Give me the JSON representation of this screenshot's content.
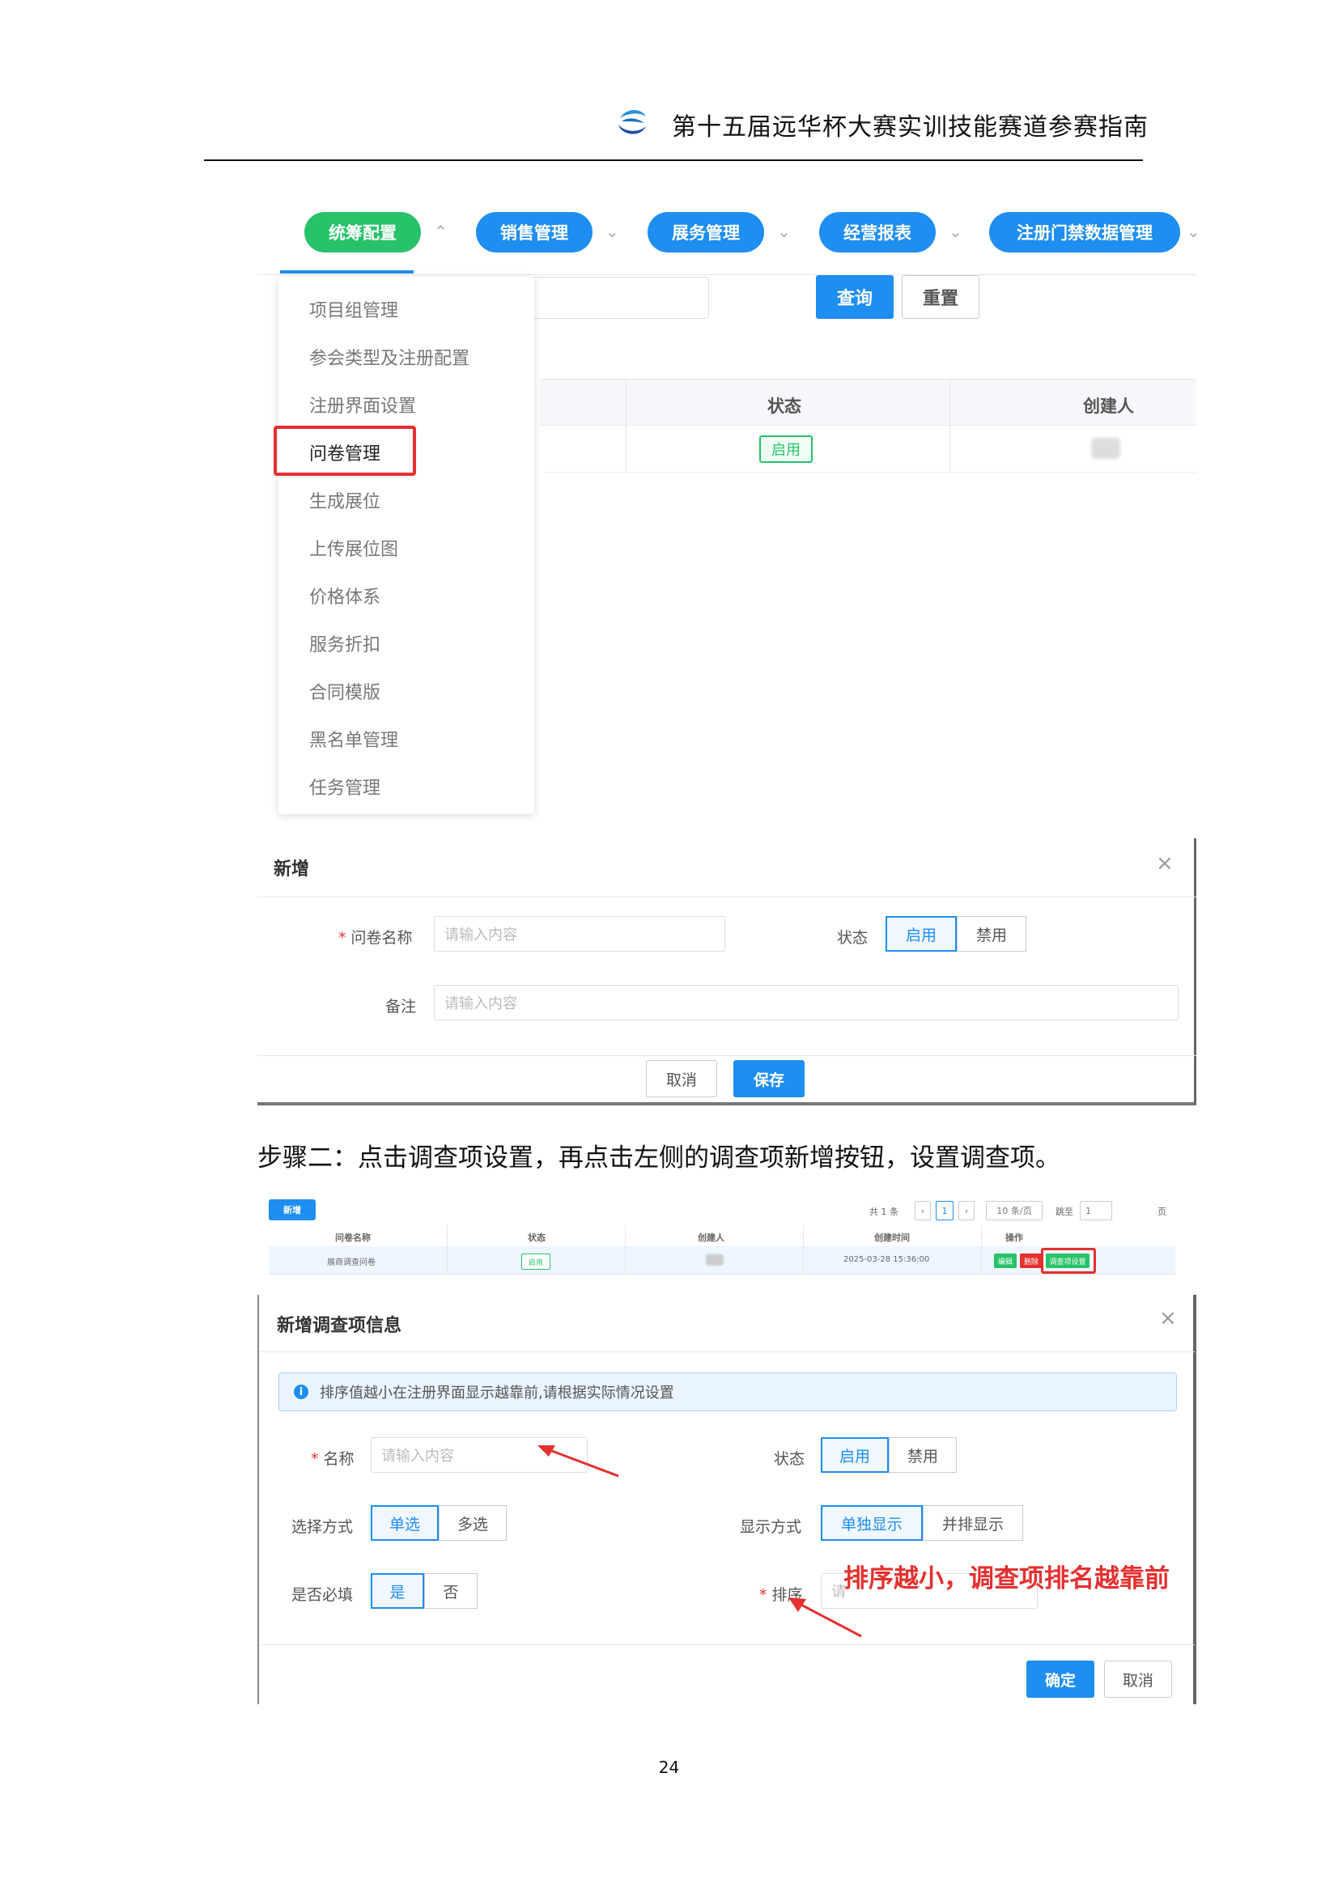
{
  "header": {
    "title": "第十五届远华杯大赛实训技能赛道参赛指南"
  },
  "screenshot1": {
    "nav": [
      {
        "label": "统筹配置",
        "color": "#27c26a"
      },
      {
        "label": "销售管理",
        "color": "#1e8ef0"
      },
      {
        "label": "展务管理",
        "color": "#1e8ef0"
      },
      {
        "label": "经营报表",
        "color": "#1e8ef0"
      },
      {
        "label": "注册门禁数据管理",
        "color": "#1e8ef0"
      }
    ],
    "query_label": "查询",
    "reset_label": "重置",
    "table_headers": {
      "status": "状态",
      "creator": "创建人"
    },
    "row_status": "启用",
    "dropdown_items": [
      "项目组管理",
      "参会类型及注册配置",
      "注册界面设置",
      "问卷管理",
      "生成展位",
      "上传展位图",
      "价格体系",
      "服务折扣",
      "合同模版",
      "黑名单管理",
      "任务管理"
    ],
    "dialog": {
      "title": "新增",
      "name_label": "问卷名称",
      "name_placeholder": "请输入内容",
      "status_label": "状态",
      "enable": "启用",
      "disable": "禁用",
      "remark_label": "备注",
      "remark_placeholder": "请输入内容",
      "cancel": "取消",
      "save": "保存"
    }
  },
  "step_text": "步骤二：点击调查项设置，再点击左侧的调查项新增按钮，设置调查项。",
  "screenshot2": {
    "new_label": "新增",
    "total": "共 1 条",
    "page": "1",
    "per_page": "10 条/页",
    "goto_label": "跳至",
    "goto_value": "1",
    "page_suffix": "页",
    "headers": [
      "问卷名称",
      "状态",
      "创建人",
      "创建时间",
      "操作"
    ],
    "row": {
      "name": "展商调查问卷",
      "status": "启用",
      "created": "2025-03-28 15:36:00",
      "edit": "编辑",
      "delete": "删除",
      "survey_settings": "调查项设置"
    }
  },
  "dialog2": {
    "title": "新增调查项信息",
    "info": "排序值越小在注册界面显示越靠前,请根据实际情况设置",
    "name_label": "名称",
    "name_placeholder": "请输入内容",
    "status_label": "状态",
    "enable": "启用",
    "disable": "禁用",
    "select_label": "选择方式",
    "single": "单选",
    "multi": "多选",
    "display_label": "显示方式",
    "display_single": "单独显示",
    "display_side": "并排显示",
    "required_label": "是否必填",
    "yes": "是",
    "no": "否",
    "sort_label": "排序",
    "sort_placeholder": "请",
    "annotation": "排序越小，调查项排名越靠前",
    "ok": "确定",
    "cancel": "取消"
  },
  "page_number": "24"
}
